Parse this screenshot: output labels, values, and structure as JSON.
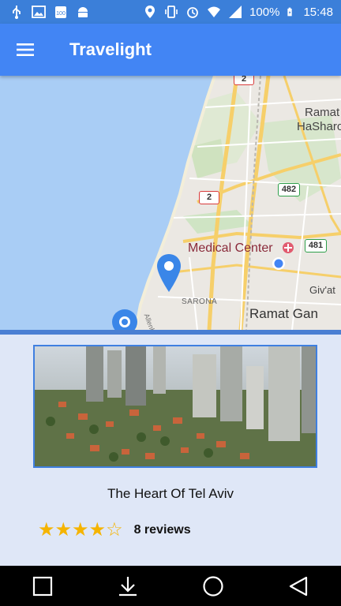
{
  "status_bar": {
    "battery": "100%",
    "time": "15:48",
    "icons": [
      "usb-icon",
      "image-icon",
      "badge-100-icon",
      "android-icon",
      "location-icon",
      "vibrate-icon",
      "alarm-icon",
      "wifi-icon",
      "signal-icon",
      "battery-charging-icon"
    ]
  },
  "app_bar": {
    "title": "Travelight",
    "menu_icon": "menu-icon",
    "color": "#4285f4"
  },
  "map": {
    "labels": {
      "medical_center": "Medical Center",
      "ramat_gan": "Ramat Gan",
      "ramat_hasharon_1": "Ramat",
      "ramat_hasharon_2": "HaSharo",
      "givat": "Giv'at",
      "sarona": "SARONA",
      "allenby": "Allenby St"
    },
    "road_badges": {
      "r2_top": "2",
      "r2_mid": "2",
      "r482": "482",
      "r481": "481"
    },
    "sea_color": "#a9cdf5"
  },
  "place": {
    "name": "The Heart Of Tel Aviv",
    "rating": 4,
    "max_rating": 5,
    "reviews": "8 reviews"
  },
  "nav_bar": {
    "icons": [
      "recent-apps-icon",
      "download-icon",
      "home-icon",
      "back-icon"
    ]
  }
}
